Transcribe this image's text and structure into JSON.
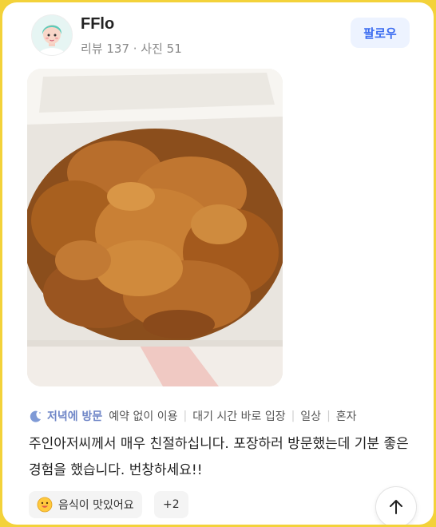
{
  "profile": {
    "username": "FFlo",
    "stats": "리뷰 137 · 사진 51",
    "follow_label": "팔로우",
    "avatar_icon": "avatar-icon"
  },
  "photo": {
    "description_icon": "fried-chicken-photo"
  },
  "tags": {
    "visit_icon": "moon-icon",
    "visit_label": "저녁에 방문",
    "items": [
      "예약 없이 이용",
      "대기 시간 바로 입장",
      "일상",
      "혼자"
    ]
  },
  "review": {
    "text": "주인아저씨께서 매우 친절하십니다. 포장하러 방문했는데 기분 좋은 경험을 했습니다. 번창하세요!!"
  },
  "chips": {
    "taste_label": "음식이 맛있어요",
    "taste_icon": "smile-emoji-icon",
    "more_label": "+2"
  },
  "scroll_top": {
    "icon": "arrow-up-icon"
  },
  "colors": {
    "frame": "#f3d23a",
    "accent": "#3b6cf0",
    "visit": "#6f86c7"
  }
}
